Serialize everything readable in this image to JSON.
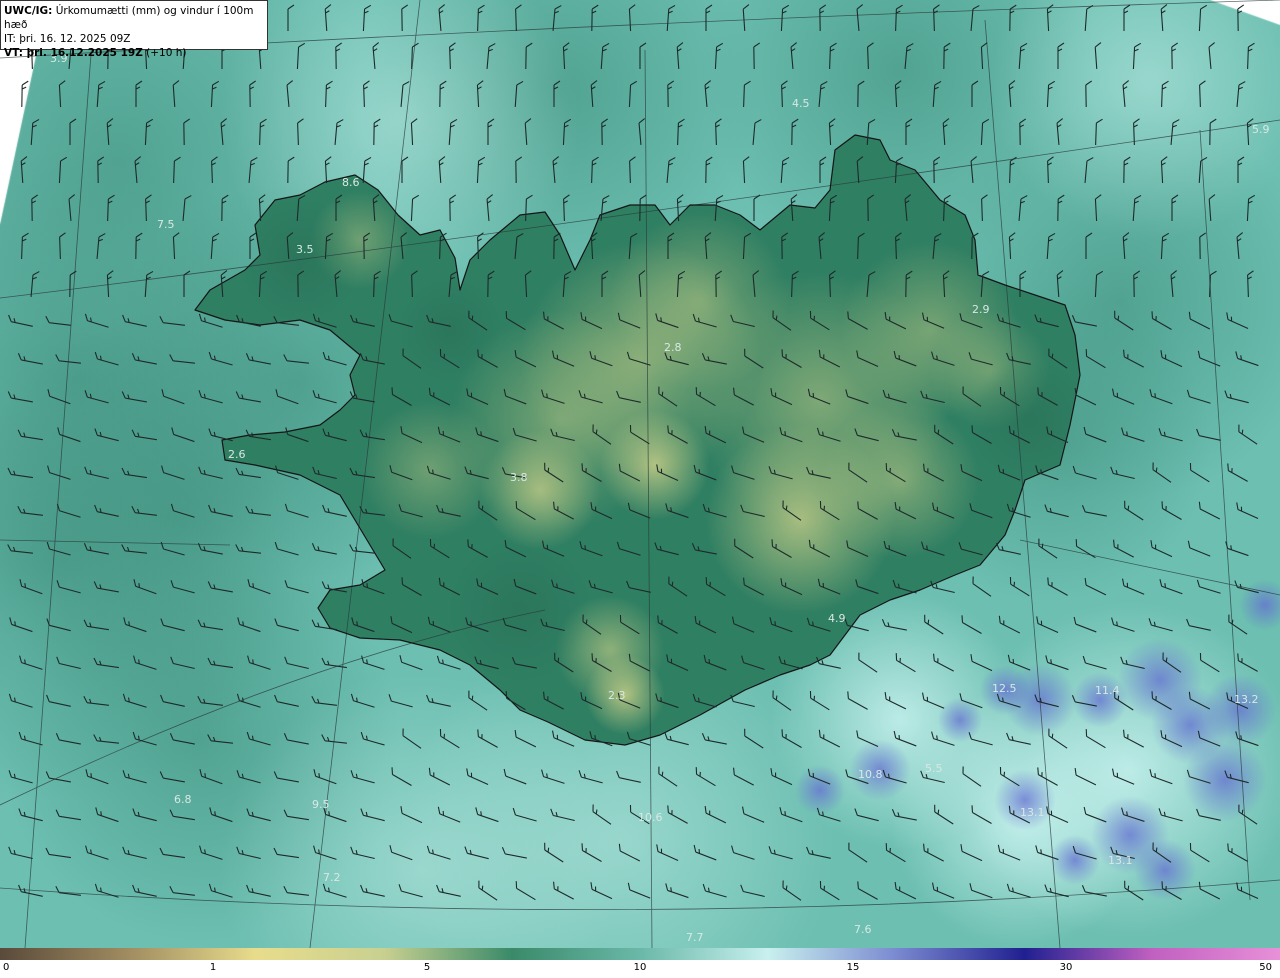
{
  "header": {
    "product": "UWC/IG:",
    "description": "Úrkomumætti (mm) og vindur í 100m hæð",
    "issue_time": "IT: þri. 16. 12. 2025 09Z",
    "valid_prefix": "VT: þri. 16.12.2025 19Z",
    "valid_suffix": "(+10 h)"
  },
  "value_labels": [
    "3.9",
    "4.5",
    "5.9",
    "7.5",
    "3.5",
    "8.6",
    "2.9",
    "2.8",
    "2.6",
    "3.8",
    "4.9",
    "2.3",
    "12.5",
    "11.4",
    "13.2",
    "10.8",
    "5.5",
    "13.1",
    "13.1",
    "9.5",
    "6.8",
    "10.6",
    "7.2",
    "7.7",
    "7.6"
  ],
  "colorbar": {
    "ticks": [
      "0",
      "1",
      "5",
      "10",
      "15",
      "30",
      "50"
    ],
    "stops": [
      "#5a4a3a",
      "#a08c60",
      "#e8dc8c",
      "#c8d090",
      "#3a8a6a",
      "#6ab8a8",
      "#c8f0ee",
      "#7a8ad0",
      "#202090",
      "#c060c0",
      "#e890d8"
    ]
  },
  "colors": {
    "sea": "#6cbfb1",
    "land_low": "#2f7f63",
    "land_high": "#cfd28a",
    "heavy_precip": "#6a7ed0",
    "coastline": "#1a1a1a",
    "barbs": "#1e2a2a"
  }
}
